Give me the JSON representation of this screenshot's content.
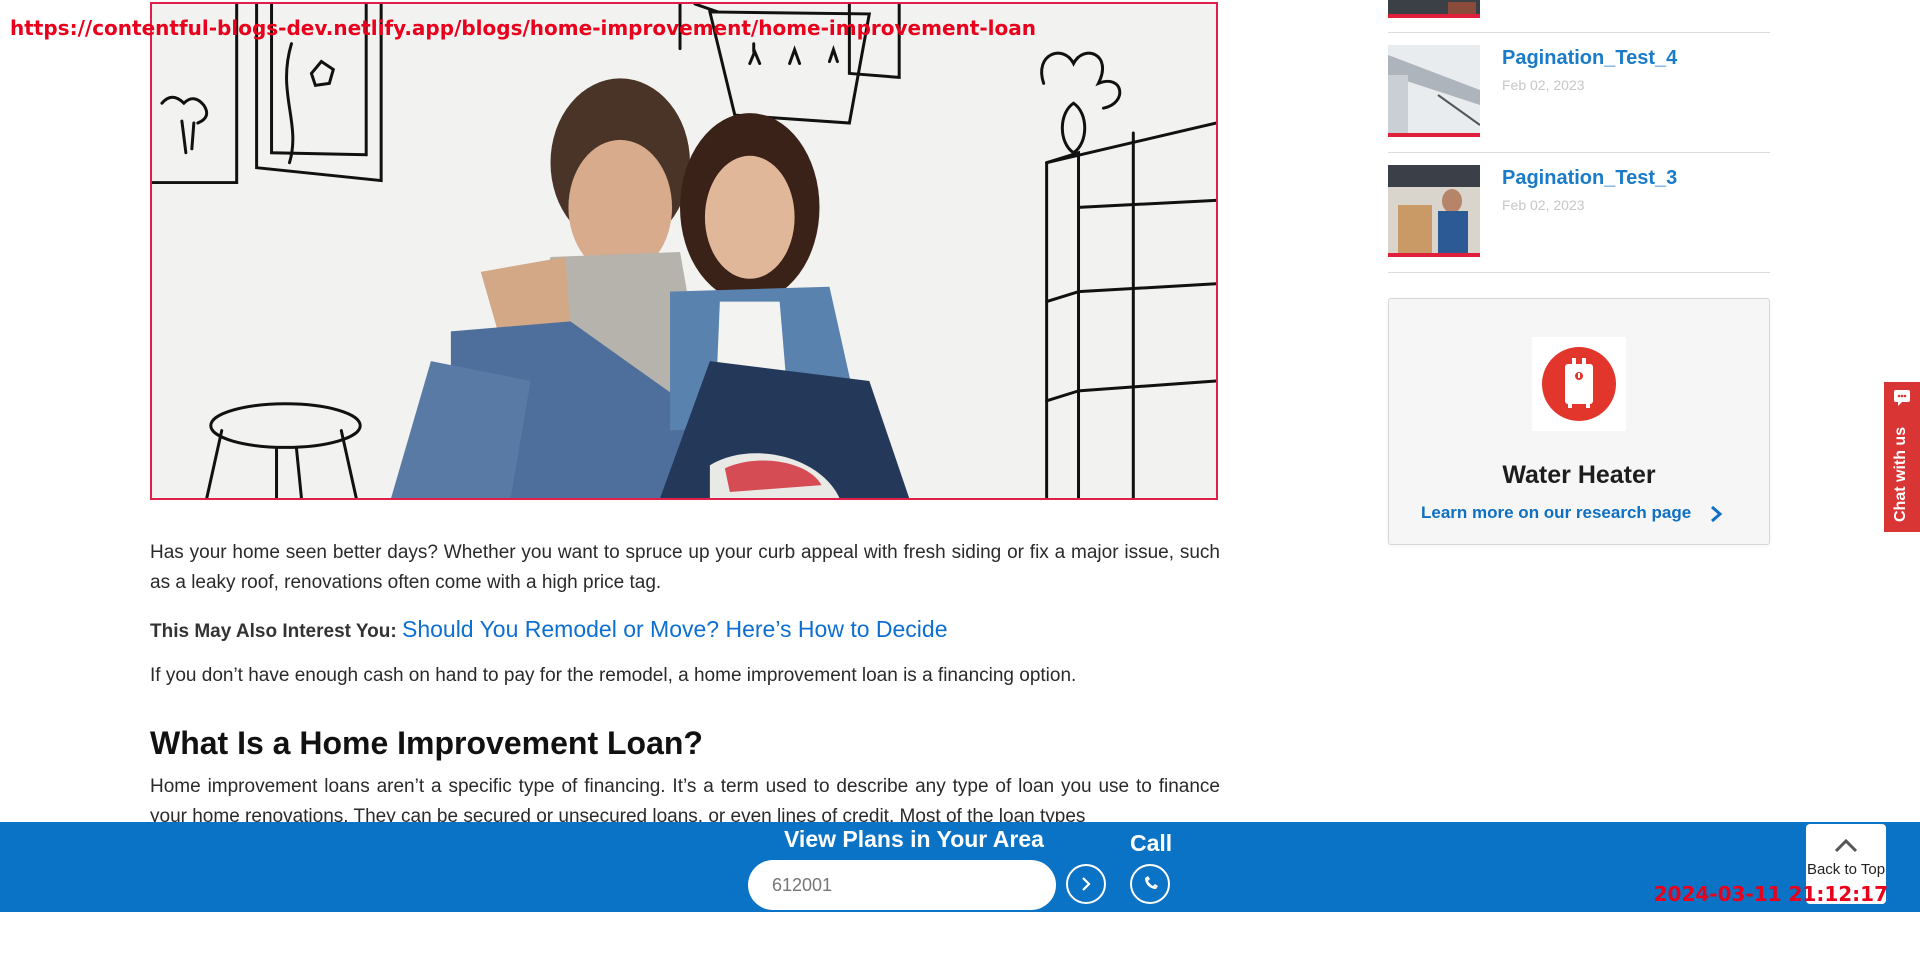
{
  "overlay": {
    "url": "https://contentful-blogs-dev.netlify.app/blogs/home-improvement/home-improvement-loan",
    "timestamp": "2024-03-11 21:12:17"
  },
  "article": {
    "intro": "Has your home seen better days? Whether you want to spruce up your curb appeal with fresh siding or fix a major issue, such as a leaky roof, renovations often come with a high price tag.",
    "interest_label": "This May Also Interest You:",
    "interest_link": "Should You Remodel or Move? Here’s How to Decide",
    "financing": "If you don’t have enough cash on hand to pay for the remodel, a home improvement loan is a financing option.",
    "heading": "What Is a Home Improvement Loan?",
    "body": "Home improvement loans aren’t a specific type of financing. It’s a term used to describe any type of loan you use to finance your home renovations. They can be secured or unsecured loans, or even lines of credit. Most of the loan types"
  },
  "sidebar": {
    "posts": [
      {
        "title": "Pagination_Test_4",
        "date": "Feb 02, 2023"
      },
      {
        "title": "Pagination_Test_3",
        "date": "Feb 02, 2023"
      }
    ],
    "card": {
      "title": "Water Heater",
      "link": "Learn more on our research page"
    }
  },
  "chat": {
    "label": "Chat with us"
  },
  "bottom_bar": {
    "view_title": "View Plans in Your Area",
    "zip_value": "612001",
    "call_label": "Call",
    "back_to_top": "Back to Top"
  },
  "colors": {
    "brand_blue": "#0a73c6",
    "link_blue": "#1a7bc8",
    "accent_red": "#e0203a"
  }
}
